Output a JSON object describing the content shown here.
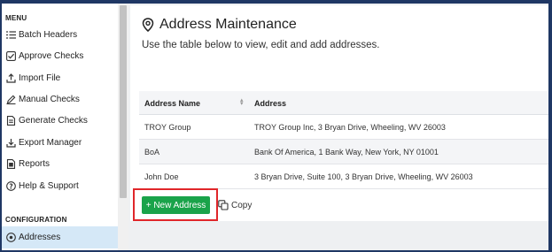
{
  "sidebar": {
    "menu_title": "MENU",
    "menu_items": [
      {
        "label": "Batch Headers",
        "icon": "list-icon"
      },
      {
        "label": "Approve Checks",
        "icon": "checkbox-icon"
      },
      {
        "label": "Import File",
        "icon": "upload-icon"
      },
      {
        "label": "Manual Checks",
        "icon": "pencil-icon"
      },
      {
        "label": "Generate Checks",
        "icon": "document-icon"
      },
      {
        "label": "Export Manager",
        "icon": "download-icon"
      },
      {
        "label": "Reports",
        "icon": "report-icon"
      },
      {
        "label": "Help & Support",
        "icon": "help-icon"
      }
    ],
    "config_title": "CONFIGURATION",
    "config_items": [
      {
        "label": "Addresses",
        "icon": "location-pin-icon",
        "active": true
      }
    ]
  },
  "main": {
    "title": "Address Maintenance",
    "subtitle": "Use the table below to view, edit and add addresses.",
    "table": {
      "columns": [
        "Address Name",
        "Address"
      ],
      "rows": [
        [
          "TROY Group",
          "TROY Group Inc, 3 Bryan Drive, Wheeling, WV 26003"
        ],
        [
          "BoA",
          "Bank Of America, 1 Bank Way, New York, NY 01001"
        ],
        [
          "John Doe",
          "3 Bryan Drive, Suite 100, 3 Bryan Drive, Wheeling, WV 26003"
        ]
      ]
    },
    "new_button": "+ New Address",
    "copy_button": "Copy"
  },
  "colors": {
    "frame": "#1f3764",
    "accent_green": "#1aa34a",
    "highlight_red": "#e0262a",
    "active_nav": "#d5e8f7"
  }
}
